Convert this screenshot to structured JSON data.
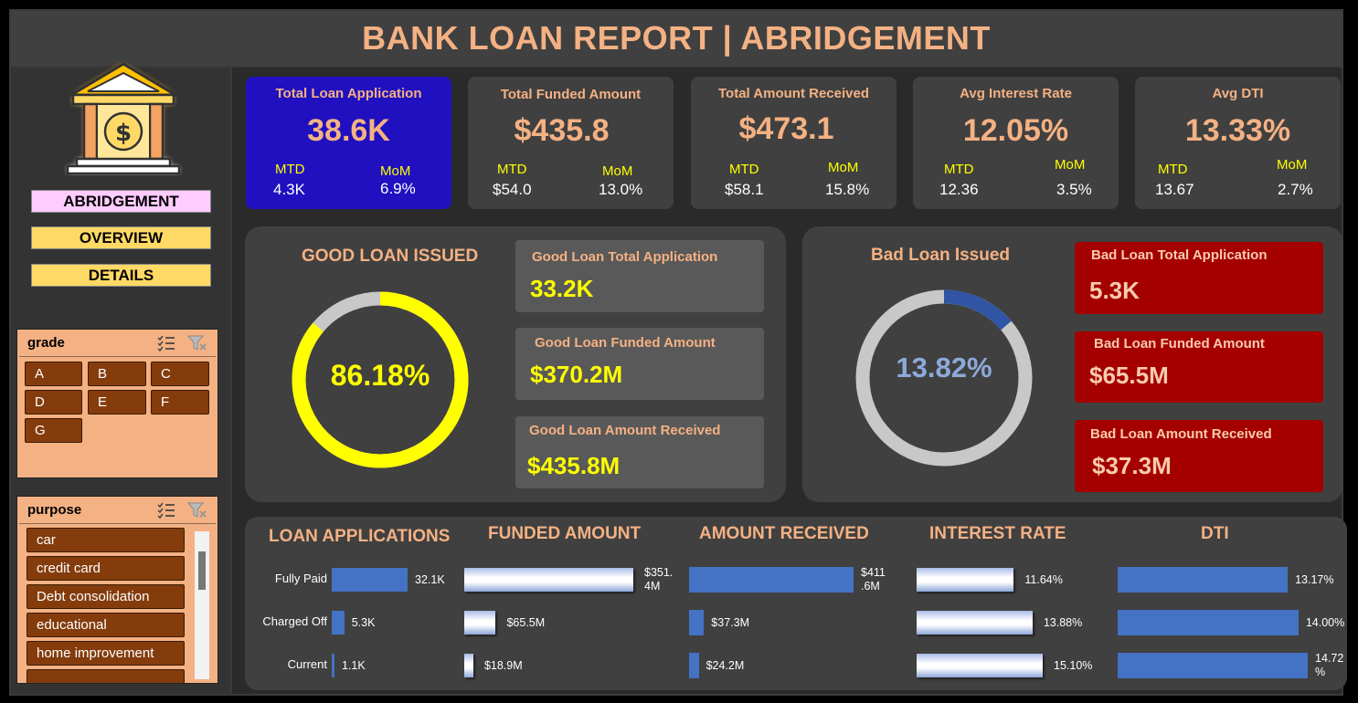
{
  "title": "BANK LOAN REPORT | ABRIDGEMENT",
  "nav": {
    "abridgement": "ABRIDGEMENT",
    "overview": "OVERVIEW",
    "details": "DETAILS"
  },
  "slicers": {
    "grade": {
      "title": "grade",
      "items": [
        "A",
        "B",
        "C",
        "D",
        "E",
        "F",
        "G"
      ]
    },
    "purpose": {
      "title": "purpose",
      "items": [
        "car",
        "credit card",
        "Debt consolidation",
        "educational",
        "home improvement"
      ]
    }
  },
  "kpis": [
    {
      "title": "Total Loan Application",
      "value": "38.6K",
      "mtd_label": "MTD",
      "mtd": "4.3K",
      "mom_label": "MoM",
      "mom": "6.9%"
    },
    {
      "title": "Total Funded Amount",
      "value": "$435.8",
      "mtd_label": "MTD",
      "mtd": "$54.0",
      "mom_label": "MoM",
      "mom": "13.0%"
    },
    {
      "title": "Total Amount Received",
      "value": "$473.1",
      "mtd_label": "MTD",
      "mtd": "$58.1",
      "mom_label": "MoM",
      "mom": "15.8%"
    },
    {
      "title": "Avg Interest Rate",
      "value": "12.05%",
      "mtd_label": "MTD",
      "mtd": "12.36",
      "mom_label": "MoM",
      "mom": "3.5%"
    },
    {
      "title": "Avg DTI",
      "value": "13.33%",
      "mtd_label": "MTD",
      "mtd": "13.67",
      "mom_label": "MoM",
      "mom": "2.7%"
    }
  ],
  "good": {
    "title": "GOOD LOAN ISSUED",
    "percent_label": "86.18%",
    "percent": 86.18,
    "cards": [
      {
        "label": "Good Loan Total Application",
        "value": "33.2K"
      },
      {
        "label": "Good Loan Funded Amount",
        "value": "$370.2M"
      },
      {
        "label": "Good Loan Amount Received",
        "value": "$435.8M"
      }
    ],
    "colors": {
      "fill": "#ffff00",
      "track": "#c8c8c8"
    }
  },
  "bad": {
    "title": "Bad Loan Issued",
    "percent_label": "13.82%",
    "percent": 13.82,
    "cards": [
      {
        "label": "Bad Loan Total Application",
        "value": "5.3K"
      },
      {
        "label": "Bad Loan Funded Amount",
        "value": "$65.5M"
      },
      {
        "label": "Bad Loan Amount Received",
        "value": "$37.3M"
      }
    ],
    "colors": {
      "fill": "#2f55a4",
      "track": "#c8c8c8"
    }
  },
  "chart_data": [
    {
      "type": "bar",
      "title": "LOAN APPLICATIONS",
      "categories": [
        "Fully Paid",
        "Charged Off",
        "Current"
      ],
      "values": [
        32.1,
        5.3,
        1.1
      ],
      "labels": [
        "32.1K",
        "5.3K",
        "1.1K"
      ]
    },
    {
      "type": "bar",
      "title": "FUNDED AMOUNT",
      "categories": [
        "Fully Paid",
        "Charged Off",
        "Current"
      ],
      "values": [
        351.4,
        65.5,
        18.9
      ],
      "labels": [
        "$351.\n4M",
        "$65.5M",
        "$18.9M"
      ]
    },
    {
      "type": "bar",
      "title": "AMOUNT RECEIVED",
      "categories": [
        "Fully Paid",
        "Charged Off",
        "Current"
      ],
      "values": [
        411.6,
        37.3,
        24.2
      ],
      "labels": [
        "$411\n.6M",
        "$37.3M",
        "$24.2M"
      ]
    },
    {
      "type": "bar",
      "title": "INTEREST RATE",
      "categories": [
        "Fully Paid",
        "Charged Off",
        "Current"
      ],
      "values": [
        11.64,
        13.88,
        15.1
      ],
      "labels": [
        "11.64%",
        "13.88%",
        "15.10%"
      ]
    },
    {
      "type": "bar",
      "title": "DTI",
      "categories": [
        "Fully Paid",
        "Charged Off",
        "Current"
      ],
      "values": [
        13.17,
        14.0,
        14.72
      ],
      "labels": [
        "13.17%",
        "14.00%",
        "14.72\n%"
      ]
    }
  ]
}
